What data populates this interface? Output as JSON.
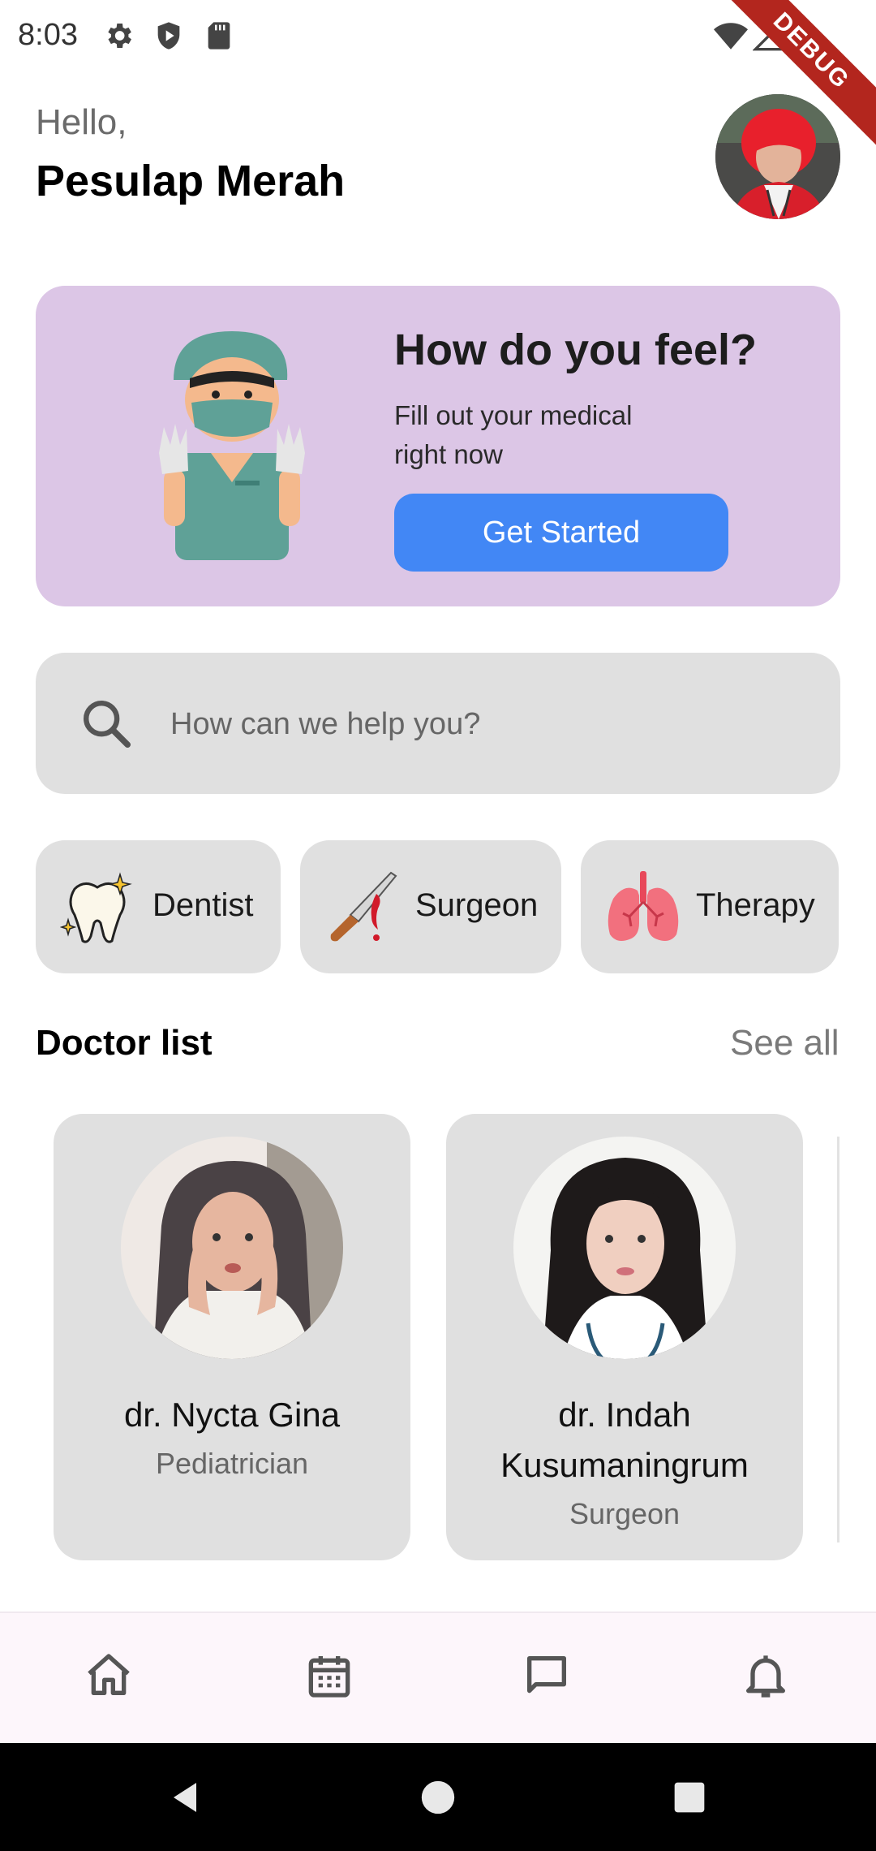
{
  "status_bar": {
    "time": "8:03",
    "left_icons": [
      "gear-icon",
      "shield-icon",
      "sd-card-icon"
    ],
    "right_icons": [
      "wifi-icon",
      "signal-icon",
      "battery-icon"
    ],
    "debug_label": "DEBUG"
  },
  "header": {
    "greeting": "Hello,",
    "user_name": "Pesulap Merah"
  },
  "banner": {
    "title": "How do you feel?",
    "subtitle": "Fill out your medical right now",
    "cta_label": "Get Started",
    "bg_color": "#dcc6e6",
    "cta_color": "#4287f5"
  },
  "search": {
    "placeholder": "How can we help you?"
  },
  "categories": [
    {
      "label": "Dentist",
      "icon": "tooth-icon"
    },
    {
      "label": "Surgeon",
      "icon": "scalpel-icon"
    },
    {
      "label": "Therapy",
      "icon": "lungs-icon"
    }
  ],
  "doctor_list": {
    "title": "Doctor list",
    "see_all": "See all",
    "doctors": [
      {
        "name": "dr. Nycta Gina",
        "specialty": "Pediatrician"
      },
      {
        "name": "dr. Indah Kusumaningrum",
        "specialty": "Surgeon"
      }
    ]
  },
  "bottom_nav": {
    "items": [
      "home-icon",
      "calendar-icon",
      "chat-icon",
      "bell-icon"
    ]
  },
  "system_nav": {
    "items": [
      "back-icon",
      "home-circle-icon",
      "recents-icon"
    ]
  }
}
